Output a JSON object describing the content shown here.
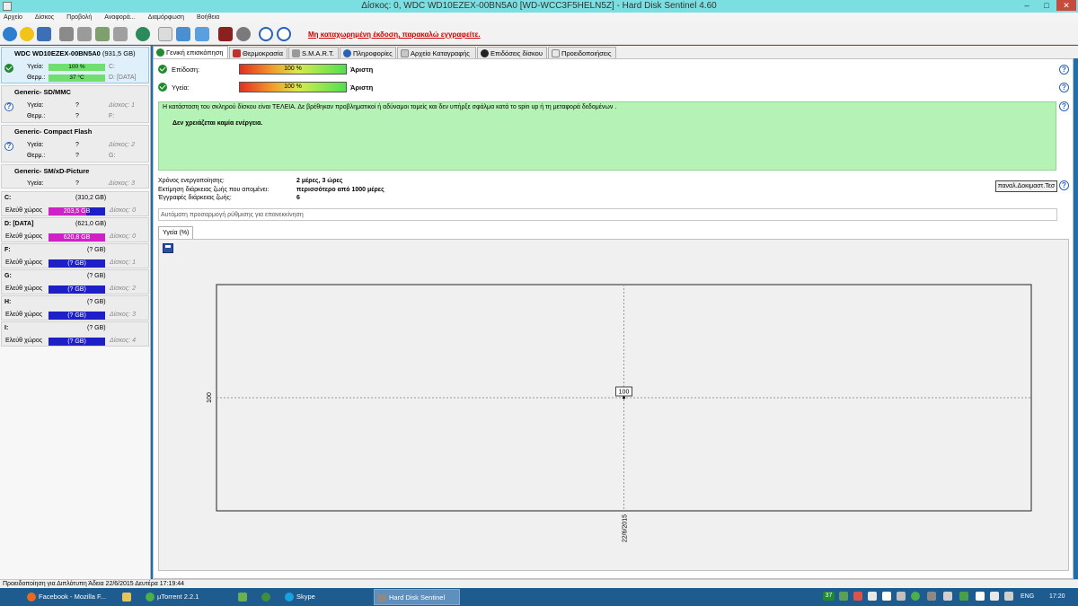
{
  "window": {
    "title": "Δίσκος: 0, WDC WD10EZEX-00BN5A0 [WD-WCC3F5HELN5Z]  -  Hard Disk Sentinel 4.60",
    "min": "–",
    "max": "□",
    "close": "✕"
  },
  "menu": [
    "Αρχείο",
    "Δίσκος",
    "Προβολή",
    "Αναφορά...",
    "Διαμόρφωση",
    "Βοήθεια"
  ],
  "toolbar": {
    "registration": "Μη καταχωρημένη έκδοση, παρακαλώ εγγραφείτε."
  },
  "left": {
    "disk0": {
      "name": "WDC WD10EZEX-00BN5A0",
      "size": "(931,5 GB)",
      "health_label": "Υγεία:",
      "health_value": "100 %",
      "health_drive": "C:",
      "temp_label": "Θερμ.:",
      "temp_value": "37 °C",
      "temp_drive": "D: [DATA]"
    },
    "readers": [
      {
        "name": "Generic- SD/MMC",
        "health_label": "Υγεία:",
        "health": "?",
        "disk": "Δίσκος: 1",
        "temp_label": "Θερμ.:",
        "temp": "?",
        "drive": "F:"
      },
      {
        "name": "Generic- Compact Flash",
        "health_label": "Υγεία:",
        "health": "?",
        "disk": "Δίσκος: 2",
        "temp_label": "Θερμ.:",
        "temp": "?",
        "drive": "G:"
      },
      {
        "name": "Generic- SM/xD-Picture",
        "health_label": "Υγεία:",
        "health": "?",
        "disk": "Δίσκος: 3"
      }
    ],
    "volumes": [
      {
        "drive": "C:",
        "size": "(310,2 GB)",
        "free_label": "Ελεύθ χώρος",
        "free": "203,5 GB",
        "disk": "Δίσκος: 0",
        "fill": 0.66
      },
      {
        "drive": "D: [DATA]",
        "size": "(621,0 GB)",
        "free_label": "Ελεύθ χώρος",
        "free": "620,8 GB",
        "disk": "Δίσκος: 0",
        "fill": 1.0
      },
      {
        "drive": "F:",
        "size": "(? GB)",
        "free_label": "Ελεύθ χώρος",
        "free": "(? GB)",
        "disk": "Δίσκος: 1",
        "fill": 0
      },
      {
        "drive": "G:",
        "size": "(? GB)",
        "free_label": "Ελεύθ χώρος",
        "free": "(? GB)",
        "disk": "Δίσκος: 2",
        "fill": 0
      },
      {
        "drive": "H:",
        "size": "(? GB)",
        "free_label": "Ελεύθ χώρος",
        "free": "(? GB)",
        "disk": "Δίσκος: 3",
        "fill": 0
      },
      {
        "drive": "I:",
        "size": "(? GB)",
        "free_label": "Ελεύθ χώρος",
        "free": "(? GB)",
        "disk": "Δίσκος: 4",
        "fill": 0
      }
    ]
  },
  "tabs": [
    "Γενική επισκόπηση",
    "Θερμοκρασία",
    "S.M.A.R.T.",
    "Πληροφορίες",
    "Αρχείο Καταγραφής",
    "Επιδόσεις δίσκου",
    "Προειδοποιήσεις"
  ],
  "overview": {
    "performance_label": "Επίδοση:",
    "performance_value": "100 %",
    "performance_rating": "Άριστη",
    "health_label": "Υγεία:",
    "health_value": "100 %",
    "health_rating": "Άριστη",
    "message_line1": "Η κατάσταση του σκληρού δίσκου είναι ΤΕΛΕΙΑ. Δε βρέθηκαν προβληματικοί ή αδύναμοι τομείς και δεν υπήρξε σφάλμα κατά το spin up ή τη μεταφορά δεδομένων .",
    "message_line2": "Δεν χρειάζεται καμία ενέργεια.",
    "power_on_label": "Χρόνος ενεργοποίησης:",
    "power_on_value": "2 μέρες, 3 ώρες",
    "lifetime_label": "Εκτίμηση διάρκειας ζωής που απομένει:",
    "lifetime_value": "περισσότερο από 1000 μέρες",
    "records_label": "Έγγραφές διάρκειας ζωής:",
    "records_value": "6",
    "test_button": "παναλ.Δοκιμαστ.Τεσ",
    "auto_field": "Αυτόματη προσαρμογή ρύθμισης για επανεκκίνηση",
    "subtab": "Υγεία (%)"
  },
  "chart_data": {
    "type": "line",
    "x": [
      "22/6/2015"
    ],
    "series": [
      {
        "values": [
          100
        ]
      }
    ],
    "ytick": "100",
    "point_label": "100"
  },
  "status": {
    "text": "Προειδοποίηση για Διπλότυπη  Άδεια 22/6/2015 Δευτέρα 17:19:44"
  },
  "taskbar": {
    "tasks": [
      "Facebook - Mozilla F...",
      "",
      "µTorrent 2.2.1",
      "",
      "",
      "Skype",
      "",
      "Hard Disk Sentinel"
    ],
    "tray_badge": "37",
    "lang": "ENG",
    "time": "17:20"
  }
}
